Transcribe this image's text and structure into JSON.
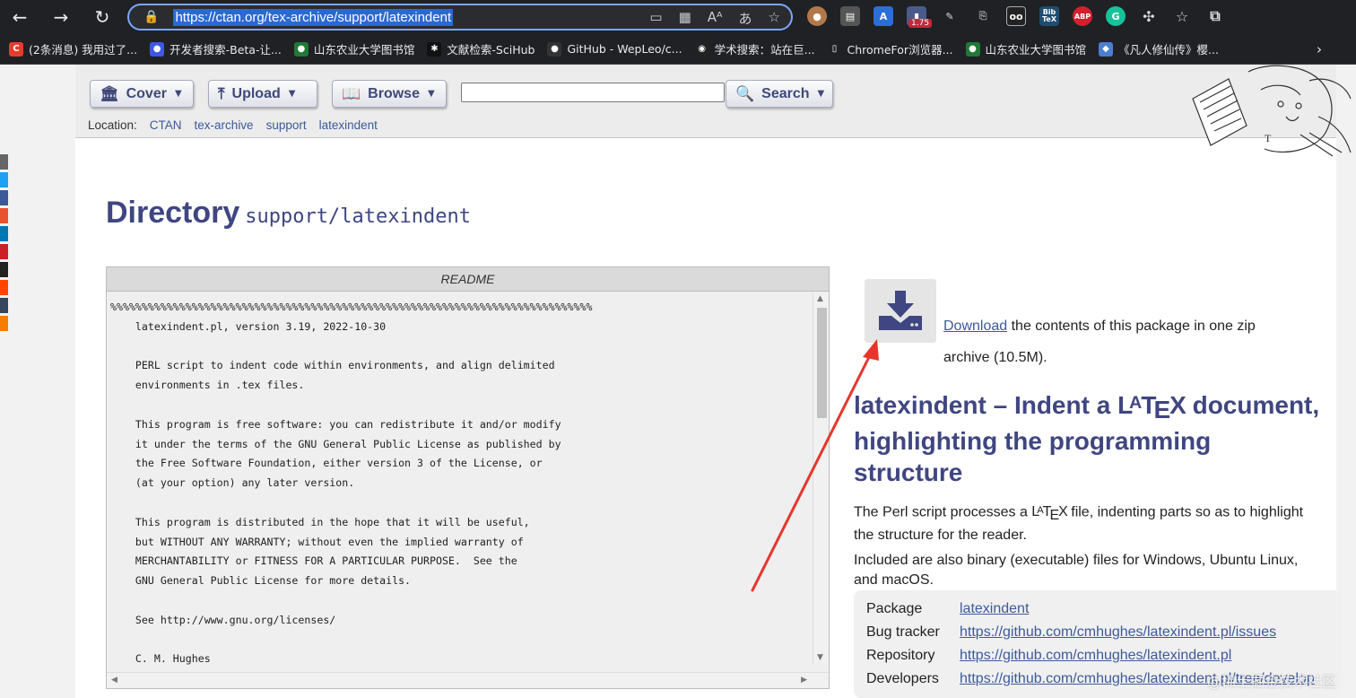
{
  "browser": {
    "url": "https://ctan.org/tex-archive/support/latexindent",
    "zoom_badge": "1.75",
    "extensions": [
      "cookie-icon",
      "reader-icon",
      "translate-icon",
      "zoom-icon",
      "pen-icon",
      "copy-icon",
      "glasses-icon",
      "bibtex-icon",
      "adblock-icon",
      "grammarly-icon",
      "puzzle-icon"
    ],
    "ext_labels": {
      "bibtex": "Bib\nTeX",
      "abp": "ABP",
      "grammarly": "G"
    }
  },
  "bookmarks": [
    {
      "label": "(2条消息) 我用过了...",
      "icon": "csdn-icon",
      "color": "#e33e2b",
      "glyph": "C"
    },
    {
      "label": "开发者搜索-Beta-让...",
      "icon": "baidu-icon",
      "color": "#3d58e6",
      "glyph": "●"
    },
    {
      "label": "山东农业大学图书馆",
      "icon": "library-icon",
      "color": "#1f7a35",
      "glyph": "●"
    },
    {
      "label": "文献检索-SciHub",
      "icon": "scihub-icon",
      "color": "#111111",
      "glyph": "✱"
    },
    {
      "label": "GitHub - WepLeo/c...",
      "icon": "github-icon",
      "color": "#333333",
      "glyph": "●"
    },
    {
      "label": "学术搜索：站在巨...",
      "icon": "panda-icon",
      "color": "#222222",
      "glyph": "◉"
    },
    {
      "label": "ChromeFor浏览器...",
      "icon": "file-icon",
      "color": "#202124",
      "glyph": "▯"
    },
    {
      "label": "山东农业大学图书馆",
      "icon": "library-icon",
      "color": "#1f7a35",
      "glyph": "●"
    },
    {
      "label": "《凡人修仙传》樱...",
      "icon": "diamond-icon",
      "color": "#4a7fd1",
      "glyph": "◆"
    }
  ],
  "topnav": {
    "cover": "Cover",
    "upload": "Upload",
    "browse": "Browse",
    "search": "Search",
    "location_label": "Location:",
    "crumbs": [
      "CTAN",
      "tex-archive",
      "support",
      "latexindent"
    ]
  },
  "heading": {
    "title": "Directory",
    "path": "support/latexindent"
  },
  "readme": {
    "title": "README",
    "lines": [
      "%%%%%%%%%%%%%%%%%%%%%%%%%%%%%%%%%%%%%%%%%%%%%%%%%%%%%%%%%%%%%%%%%%%%%%%%%%%%%",
      "    latexindent.pl, version 3.19, 2022-10-30",
      "",
      "    PERL script to indent code within environments, and align delimited",
      "    environments in .tex files.",
      "",
      "    This program is free software: you can redistribute it and/or modify",
      "    it under the terms of the GNU General Public License as published by",
      "    the Free Software Foundation, either version 3 of the License, or",
      "    (at your option) any later version.",
      "",
      "    This program is distributed in the hope that it will be useful,",
      "    but WITHOUT ANY WARRANTY; without even the implied warranty of",
      "    MERCHANTABILITY or FITNESS FOR A PARTICULAR PURPOSE.  See the",
      "    GNU General Public License for more details.",
      "",
      "    See http://www.gnu.org/licenses/",
      "",
      "    C. M. Hughes"
    ]
  },
  "download": {
    "link": "Download",
    "text": "the contents of this package in one zip archive (10.5M)."
  },
  "package": {
    "title_prefix": "latexindent – Indent a ",
    "title_suffix": " document, highlighting the programming structure",
    "desc1_prefix": "The Perl script processes a ",
    "desc1_suffix": " file, indenting parts so as to highlight the structure for the reader.",
    "desc2": "Included are also binary (executable) files for Windows, Ubuntu Linux, and macOS."
  },
  "info": [
    {
      "key": "Package",
      "value": "latexindent"
    },
    {
      "key": "Bug tracker",
      "value": "https://github.com/cmhughes/latexindent.pl/issues"
    },
    {
      "key": "Repository",
      "value": "https://github.com/cmhughes/latexindent.pl"
    },
    {
      "key": "Developers",
      "value": "https://github.com/cmhughes/latexindent.pl/tree/develop"
    }
  ],
  "watermark": "@稀土掘金技术社区",
  "colors": {
    "accent": "#3f4681",
    "link": "#3c5a9a",
    "annotation_arrow": "#e8352b",
    "address_border": "#7aa7ff"
  },
  "share_colors": [
    "#666666",
    "#1da1f2",
    "#3b5998",
    "#e9542f",
    "#0077b5",
    "#cb2027",
    "#222222",
    "#ff4500",
    "#35465c",
    "#f57d00"
  ]
}
